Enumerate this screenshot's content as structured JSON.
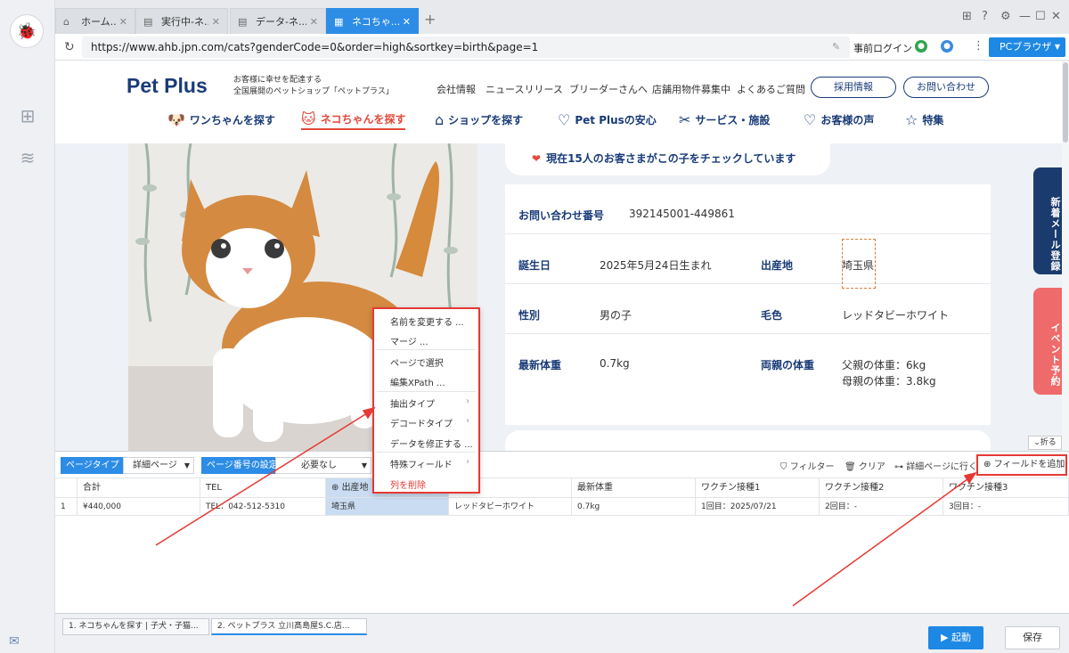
{
  "tabs": [
    {
      "label": "ホーム...",
      "icon": "home-icon"
    },
    {
      "label": "実行中-ネ...",
      "icon": "document-icon"
    },
    {
      "label": "データ-ネ...",
      "icon": "document-icon"
    },
    {
      "label": "ネコちゃ...",
      "icon": "calendar-icon"
    }
  ],
  "address": {
    "url": "https://www.ahb.jpn.com/cats?genderCode=0&order=high&sortkey=birth&page=1",
    "login": "事前ログイン",
    "browser": "PCブラウザ"
  },
  "site": {
    "brand": "Pet Plus",
    "tagline1": "お客様に幸せを配達する",
    "tagline2": "全国展開のペットショップ「ペットプラス」",
    "topnav": [
      "会社情報",
      "ニュースリリース",
      "ブリーダーさんへ",
      "店舗用物件募集中",
      "よくあるご質問"
    ],
    "pills": [
      "採用情報",
      "お問い合わせ"
    ],
    "mainnav": [
      "ワンちゃんを探す",
      "ネコちゃんを探す",
      "ショップを探す",
      "Pet Plusの安心",
      "サービス・施設",
      "お客様の声",
      "特集"
    ]
  },
  "detail": {
    "check": "現在15人のお客さまがこの子をチェックしています",
    "inquiry_label": "お問い合わせ番号",
    "inquiry_value": "392145001-449861",
    "birth_label": "誕生日",
    "birth_value": "2025年5月24日生まれ",
    "origin_label": "出産地",
    "origin_value": "埼玉県",
    "sex_label": "性別",
    "sex_value": "男の子",
    "color_label": "毛色",
    "color_value": "レッドタビーホワイト",
    "weight_label": "最新体重",
    "weight_value": "0.7kg",
    "parent_label": "両親の体重",
    "father": "父親の体重：6kg",
    "mother": "母親の体重：3.8kg"
  },
  "side": {
    "mail": "新着メール登録",
    "event": "イベント予約",
    "fold": "折る"
  },
  "menu": [
    "名前を変更する ...",
    "マージ ...",
    "ページで選択",
    "編集XPath ...",
    "抽出タイプ",
    "デコードタイプ",
    "データを修正する ...",
    "特殊フィールド",
    "列を削除"
  ],
  "toolbar": {
    "page_type_label": "ページタイプ",
    "page_type_value": "詳細ページ",
    "page_num_label": "ページ番号の設定",
    "page_num_value": "必要なし",
    "filter": "フィルター",
    "clear": "クリア",
    "goto": "詳細ページに行く",
    "add": "フィールドを追加"
  },
  "grid": {
    "headers": [
      "合計",
      "TEL",
      "出産地",
      "",
      "最新体重",
      "ワクチン接種1",
      "ワクチン接種2",
      "ワクチン接種3"
    ],
    "row_index": "1",
    "row": [
      "¥440,000",
      "TEL：042-512-5310",
      "埼玉県",
      "レッドタビーホワイト",
      "0.7kg",
      "1回目：2025/07/21",
      "2回目：-",
      "3回目：-"
    ]
  },
  "bottom_tabs": [
    "1. ネコちゃんを探す | 子犬・子猫...",
    "2. ペットプラス 立川髙島屋S.C.店..."
  ],
  "actions": {
    "run": "起動",
    "save": "保存"
  },
  "colors": {
    "accent": "#2d8ce6",
    "brand": "#1a3b78",
    "alert": "#e53935"
  }
}
